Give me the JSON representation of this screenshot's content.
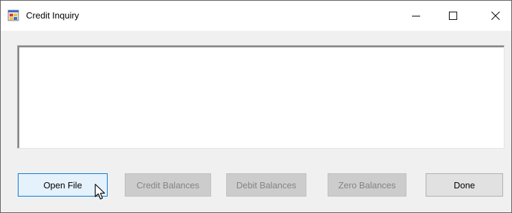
{
  "window": {
    "title": "Credit Inquiry",
    "app_icon": "winforms-app-icon",
    "caption_buttons": [
      "minimize-icon",
      "maximize-icon",
      "close-icon"
    ]
  },
  "listbox": {
    "items": []
  },
  "buttons": {
    "open_file": {
      "label": "Open File",
      "enabled": true,
      "hovered": true
    },
    "credit_balances": {
      "label": "Credit Balances",
      "enabled": false
    },
    "debit_balances": {
      "label": "Debit Balances",
      "enabled": false
    },
    "zero_balances": {
      "label": "Zero Balances",
      "enabled": false
    },
    "done": {
      "label": "Done",
      "enabled": true
    }
  },
  "colors": {
    "hover_border": "#0078d7",
    "hover_fill": "#e5f1fb",
    "disabled_text": "#838383"
  }
}
